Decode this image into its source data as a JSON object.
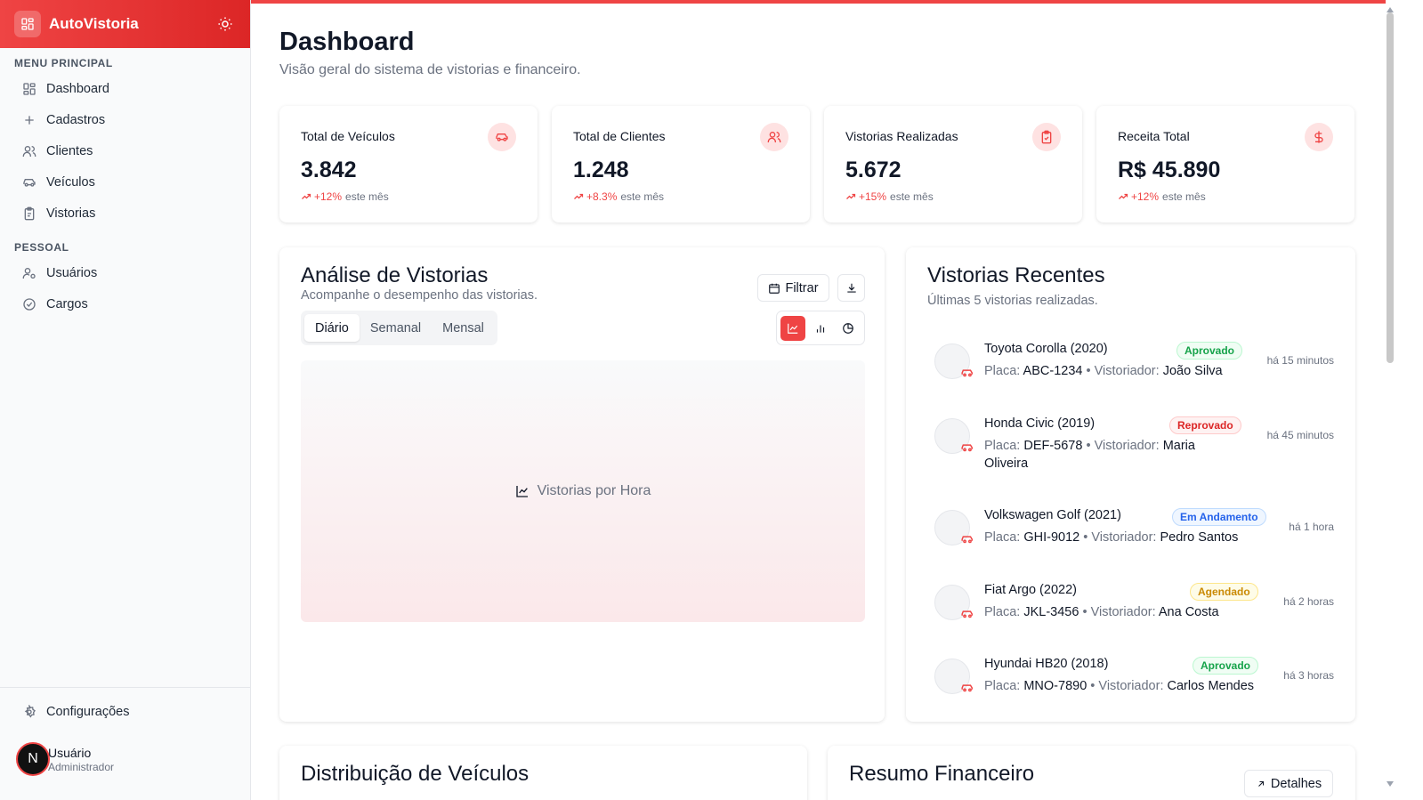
{
  "brand": {
    "name": "AutoVistoria",
    "logo_icon": "grid-icon",
    "theme_icon": "sun-icon"
  },
  "sidebar": {
    "section_main": "MENU PRINCIPAL",
    "main_items": [
      {
        "label": "Dashboard",
        "icon": "grid-icon"
      },
      {
        "label": "Cadastros",
        "icon": "plus-icon"
      },
      {
        "label": "Clientes",
        "icon": "users-icon"
      },
      {
        "label": "Veículos",
        "icon": "car-icon"
      },
      {
        "label": "Vistorias",
        "icon": "clipboard-icon"
      }
    ],
    "section_personal": "PESSOAL",
    "personal_items": [
      {
        "label": "Usuários",
        "icon": "user-gear-icon"
      },
      {
        "label": "Cargos",
        "icon": "check-circle-icon"
      }
    ],
    "settings_label": "Configurações",
    "user": {
      "initial": "N",
      "name": "Usuário",
      "role": "Administrador"
    }
  },
  "header": {
    "title": "Dashboard",
    "subtitle": "Visão geral do sistema de vistorias e financeiro."
  },
  "stats": [
    {
      "label": "Total de Veículos",
      "value": "3.842",
      "change": "+12%",
      "suffix": "este mês",
      "icon": "car-icon"
    },
    {
      "label": "Total de Clientes",
      "value": "1.248",
      "change": "+8.3%",
      "suffix": "este mês",
      "icon": "users-icon"
    },
    {
      "label": "Vistorias Realizadas",
      "value": "5.672",
      "change": "+15%",
      "suffix": "este mês",
      "icon": "clipboard-check-icon"
    },
    {
      "label": "Receita Total",
      "value": "R$ 45.890",
      "change": "+12%",
      "suffix": "este mês",
      "icon": "dollar-icon"
    }
  ],
  "analysis": {
    "title": "Análise de Vistorias",
    "subtitle": "Acompanhe o desempenho das vistorias.",
    "filter_label": "Filtrar",
    "tabs": [
      "Diário",
      "Semanal",
      "Mensal"
    ],
    "active_tab": "Diário",
    "chart_label": "Vistorias por Hora"
  },
  "recent": {
    "title": "Vistorias Recentes",
    "subtitle": "Últimas 5 vistorias realizadas.",
    "plate_label": "Placa:",
    "inspector_label": "Vistoriador:",
    "items": [
      {
        "vehicle": "Toyota Corolla (2020)",
        "plate": "ABC-1234",
        "inspector": "João Silva",
        "status": "Aprovado",
        "time": "há 15 minutos"
      },
      {
        "vehicle": "Honda Civic (2019)",
        "plate": "DEF-5678",
        "inspector": "Maria Oliveira",
        "status": "Reprovado",
        "time": "há 45 minutos"
      },
      {
        "vehicle": "Volkswagen Golf (2021)",
        "plate": "GHI-9012",
        "inspector": "Pedro Santos",
        "status": "Em Andamento",
        "time": "há 1 hora"
      },
      {
        "vehicle": "Fiat Argo (2022)",
        "plate": "JKL-3456",
        "inspector": "Ana Costa",
        "status": "Agendado",
        "time": "há 2 horas"
      },
      {
        "vehicle": "Hyundai HB20 (2018)",
        "plate": "MNO-7890",
        "inspector": "Carlos Mendes",
        "status": "Aprovado",
        "time": "há 3 horas"
      }
    ]
  },
  "distribution": {
    "title": "Distribuição de Veículos"
  },
  "finance": {
    "title": "Resumo Financeiro",
    "details_label": "Detalhes"
  },
  "colors": {
    "accent": "#ef4444",
    "approved": "#16a34a",
    "rejected": "#dc2626",
    "in_progress": "#2563eb",
    "scheduled": "#ca8a04"
  }
}
